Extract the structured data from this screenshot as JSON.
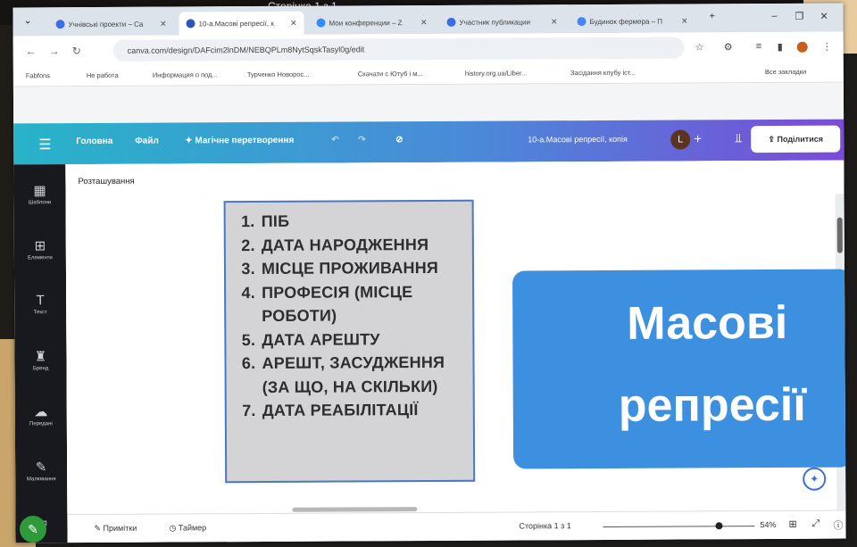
{
  "background": {
    "status_text": "Сторінка 1 з 1"
  },
  "browser": {
    "tabs": [
      {
        "label": "Учнівські проекти – Ca",
        "color": "#3a6ee8",
        "active": false
      },
      {
        "label": "10-а.Масові репресії, к",
        "color": "#2f57b8",
        "active": true
      },
      {
        "label": "Мои конференции – Z",
        "color": "#2d8cff",
        "active": false
      },
      {
        "label": "Участник публикации",
        "color": "#3a6ee8",
        "active": false
      },
      {
        "label": "Будинок фермера – П",
        "color": "#4285f4",
        "active": false
      }
    ],
    "new_tab": "+",
    "url": "canva.com/design/DAFcim2lnDM/NEBQPLm8NytSqskTasyl0g/edit",
    "bookmarks": [
      "Fabfons",
      "Не работа",
      "Информация о под...",
      "Турченко Новорос...",
      "Скачати с Ютуб і м...",
      "history.org.ua/Liber...",
      "Засідання клубу іст...",
      "Все закладки"
    ]
  },
  "canva": {
    "menu": {
      "home": "Головна",
      "file": "Файл",
      "magic": "✦ Магічне перетворення"
    },
    "doc_title": "10-а.Масові репресії, копія",
    "avatar_letter": "L",
    "share_label": "Поділитися",
    "rail": [
      {
        "icon": "▦",
        "label": "Шаблони",
        "name": "templates"
      },
      {
        "icon": "⊞",
        "label": "Елементи",
        "name": "elements"
      },
      {
        "icon": "T",
        "label": "Текст",
        "name": "text"
      },
      {
        "icon": "♜",
        "label": "Бренд",
        "name": "brand"
      },
      {
        "icon": "☁",
        "label": "Передані",
        "name": "uploads"
      },
      {
        "icon": "✎",
        "label": "Малювання",
        "name": "draw"
      },
      {
        "icon": "▭",
        "label": "",
        "name": "projects"
      }
    ],
    "subbar_label": "Розташування",
    "slide_list": [
      "ПІБ",
      "ДАТА НАРОДЖЕННЯ",
      "МІСЦЕ ПРОЖИВАННЯ",
      "ПРОФЕСІЯ (МІСЦЕ РОБОТИ)",
      "ДАТА АРЕШТУ",
      "АРЕШТ, ЗАСУДЖЕННЯ (ЗА ЩО, НА СКІЛЬКИ)",
      "ДАТА РЕАБІЛІТАЦІЇ"
    ],
    "slide_title_1": "Масові",
    "slide_title_2": "репресії",
    "footer": {
      "notes": "Примітки",
      "timer": "Таймер",
      "page": "Сторінка 1 з 1",
      "zoom": "54%",
      "zoom_fraction": 0.54
    }
  }
}
